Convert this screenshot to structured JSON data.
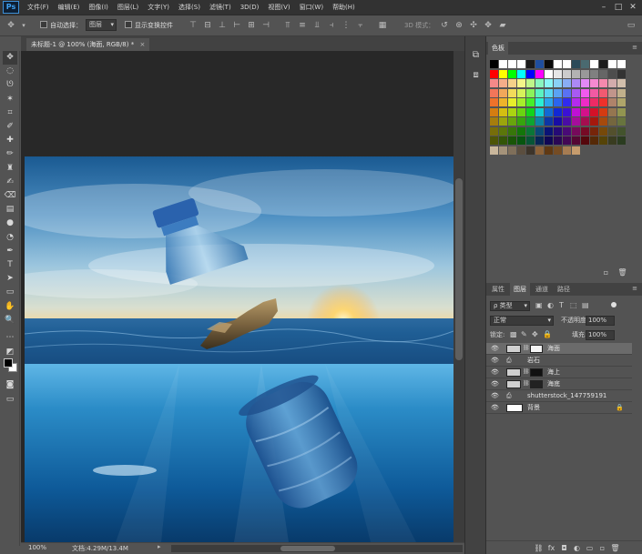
{
  "app": {
    "logo": "Ps"
  },
  "menu": [
    "文件(F)",
    "编辑(E)",
    "图像(I)",
    "图层(L)",
    "文字(Y)",
    "选择(S)",
    "滤镜(T)",
    "3D(D)",
    "视图(V)",
    "窗口(W)",
    "帮助(H)"
  ],
  "options": {
    "auto_select_label": "自动选择：",
    "auto_select_value": "图层",
    "show_transform_label": "显示变换控件",
    "mode_3d_label": "3D 模式："
  },
  "document": {
    "tab_title": "未标题-1 @ 100% (海面, RGB/8) *"
  },
  "status": {
    "zoom": "100%",
    "doc_size": "文档:4.29M/13.4M"
  },
  "swatches_panel": {
    "tab": "色板"
  },
  "layers_panel": {
    "tabs": [
      "属性",
      "图层",
      "通道",
      "路径"
    ],
    "filter_label": "ρ 类型",
    "blend_mode": "正常",
    "opacity_label": "不透明度:",
    "opacity_value": "100%",
    "lock_label": "锁定:",
    "fill_label": "填充:",
    "fill_value": "100%",
    "layers": [
      {
        "name": "海面",
        "selected": true
      },
      {
        "name": "岩石",
        "selected": false
      },
      {
        "name": "海上",
        "selected": false
      },
      {
        "name": "海底",
        "selected": false
      },
      {
        "name": "shutterstock_147759191",
        "selected": false
      },
      {
        "name": "背景",
        "selected": false
      }
    ]
  },
  "colors": {
    "swatches_row1": [
      "#000000",
      "#ffffff",
      "#ffffff",
      "#ffffff",
      "#1a1a1a",
      "#1f4e9e",
      "#0a0a0a",
      "#ffffff",
      "#ffffff",
      "#2b4a59",
      "#4a6a70",
      "#ffffff",
      "#1c1c1c",
      "#ffffff",
      "#ffffff"
    ],
    "swatches_row2": [
      "#ff0000",
      "#ffff00",
      "#00ff00",
      "#00ffff",
      "#0000ff",
      "#ff00ff",
      "#ffffff",
      "#e6e6e6",
      "#cccccc",
      "#b3b3b3",
      "#999999",
      "#808080",
      "#666666",
      "#4d4d4d",
      "#333333"
    ]
  }
}
